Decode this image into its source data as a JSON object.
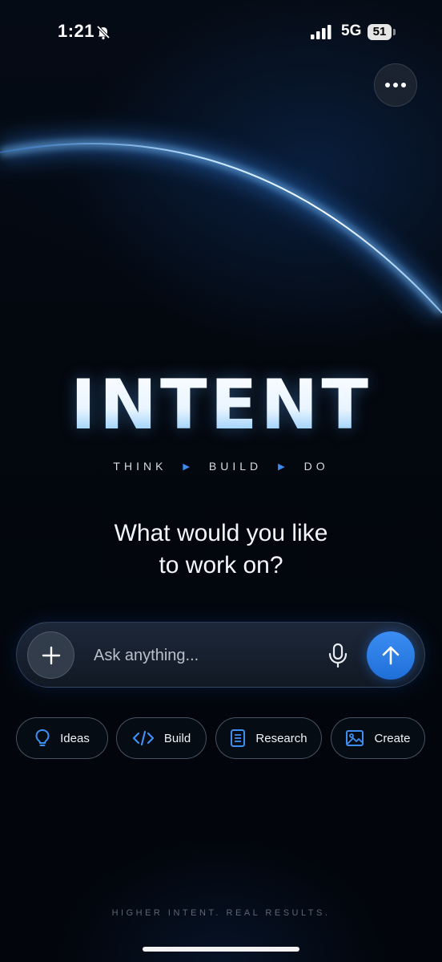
{
  "status_bar": {
    "time": "1:21",
    "network": "5G",
    "battery": "51",
    "icons": [
      "bell-slash-icon",
      "signal-icon",
      "battery-icon"
    ]
  },
  "header": {
    "more_icon": "ellipsis-icon"
  },
  "brand": {
    "title": "INTENT",
    "tagline": [
      "THINK",
      "BUILD",
      "DO"
    ],
    "tagline_separator_icon": "play-arrow-icon"
  },
  "prompt": {
    "line1": "What would you like",
    "line2": "to work on?"
  },
  "input": {
    "placeholder": "Ask anything...",
    "value": "",
    "add_icon": "plus-icon",
    "mic_icon": "microphone-icon",
    "send_icon": "arrow-up-icon"
  },
  "chips": [
    {
      "label": "Ideas",
      "icon": "lightbulb-icon"
    },
    {
      "label": "Build",
      "icon": "code-icon"
    },
    {
      "label": "Research",
      "icon": "document-icon"
    },
    {
      "label": "Create",
      "icon": "image-icon"
    }
  ],
  "footer": {
    "tagline": "HIGHER INTENT. REAL RESULTS."
  },
  "colors": {
    "accent": "#3b8df2",
    "background": "#03070e",
    "glow": "#6ab8f5"
  }
}
